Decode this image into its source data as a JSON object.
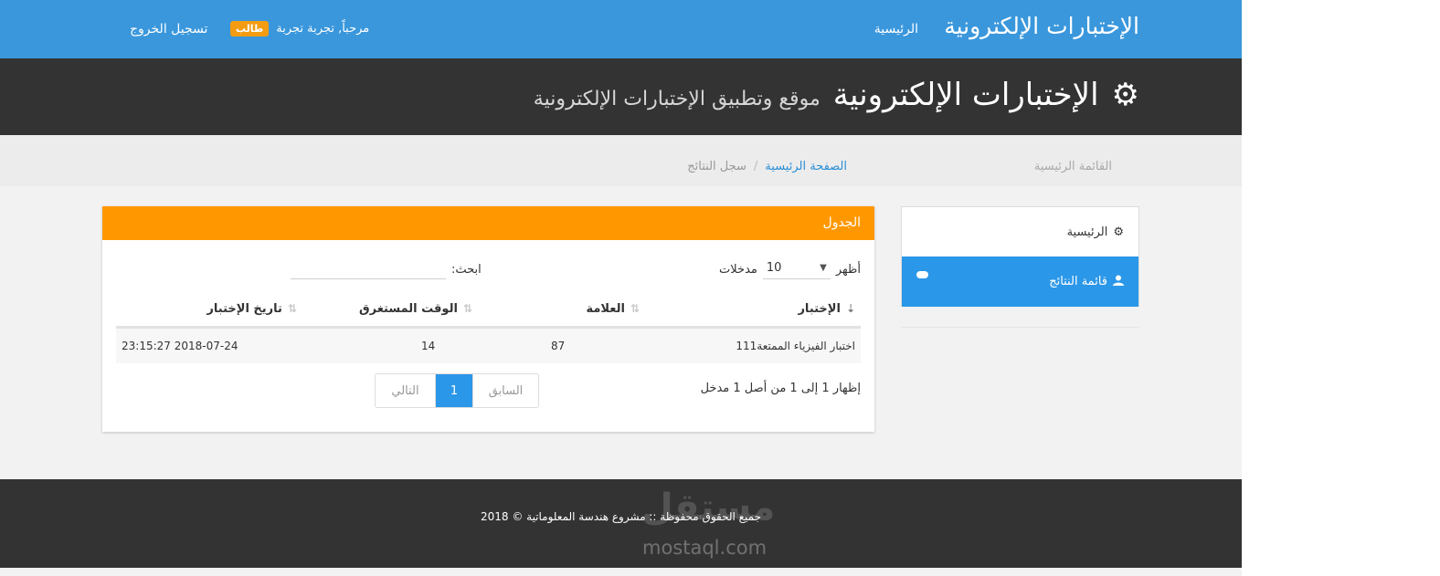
{
  "navbar": {
    "brand": "الإختبارات الإلكترونية",
    "home_link": "الرئيسية",
    "welcome": "مرحباً, تجربة تجربة",
    "role_badge": "طالب",
    "logout": "تسجيل الخروج"
  },
  "hero": {
    "icon": "gear-icon",
    "title": "الإختبارات الإلكترونية",
    "subtitle": "موقع وتطبيق الإختبارات الإلكترونية"
  },
  "breadcrumb": {
    "sidebar_title": "القائمة الرئيسية",
    "home": "الصفحة الرئيسية",
    "separator": "/",
    "current": "سجل النتائج"
  },
  "sidebar": {
    "items": [
      {
        "label": "الرئيسية",
        "icon": "gear-icon",
        "active": false
      },
      {
        "label": "قائمة النتائج",
        "icon": "user-icon",
        "active": true
      }
    ]
  },
  "panel": {
    "title": "الجدول",
    "length": {
      "show_label": "أظهر",
      "value": "10",
      "entries_label": "مدخلات"
    },
    "search": {
      "label": "ابحث:",
      "value": ""
    },
    "columns": [
      "الإختبار",
      "العلامة",
      "الوقت المستغرق",
      "تاريخ الإختبار"
    ],
    "rows": [
      {
        "exam": "اختبار الفيزياء الممتعة111",
        "score": "87",
        "time_taken": "14",
        "date": "2018-07-24 23:15:27"
      }
    ],
    "info": "إظهار 1 إلى 1 من أصل 1 مدخل",
    "pagination": {
      "previous": "السابق",
      "current": "1",
      "next": "التالي"
    }
  },
  "footer": {
    "copyright": "جميع الحقوق محفوظة :: مشروع هندسة المعلوماتية © 2018",
    "watermark_ar": "مستقل",
    "watermark_en": "mostaql.com"
  },
  "colors": {
    "navbar": "#3a97dc",
    "dark_band": "#333333",
    "accent_orange": "#ff9800",
    "active_blue": "#2b97e8",
    "badge": "#f39c12"
  }
}
